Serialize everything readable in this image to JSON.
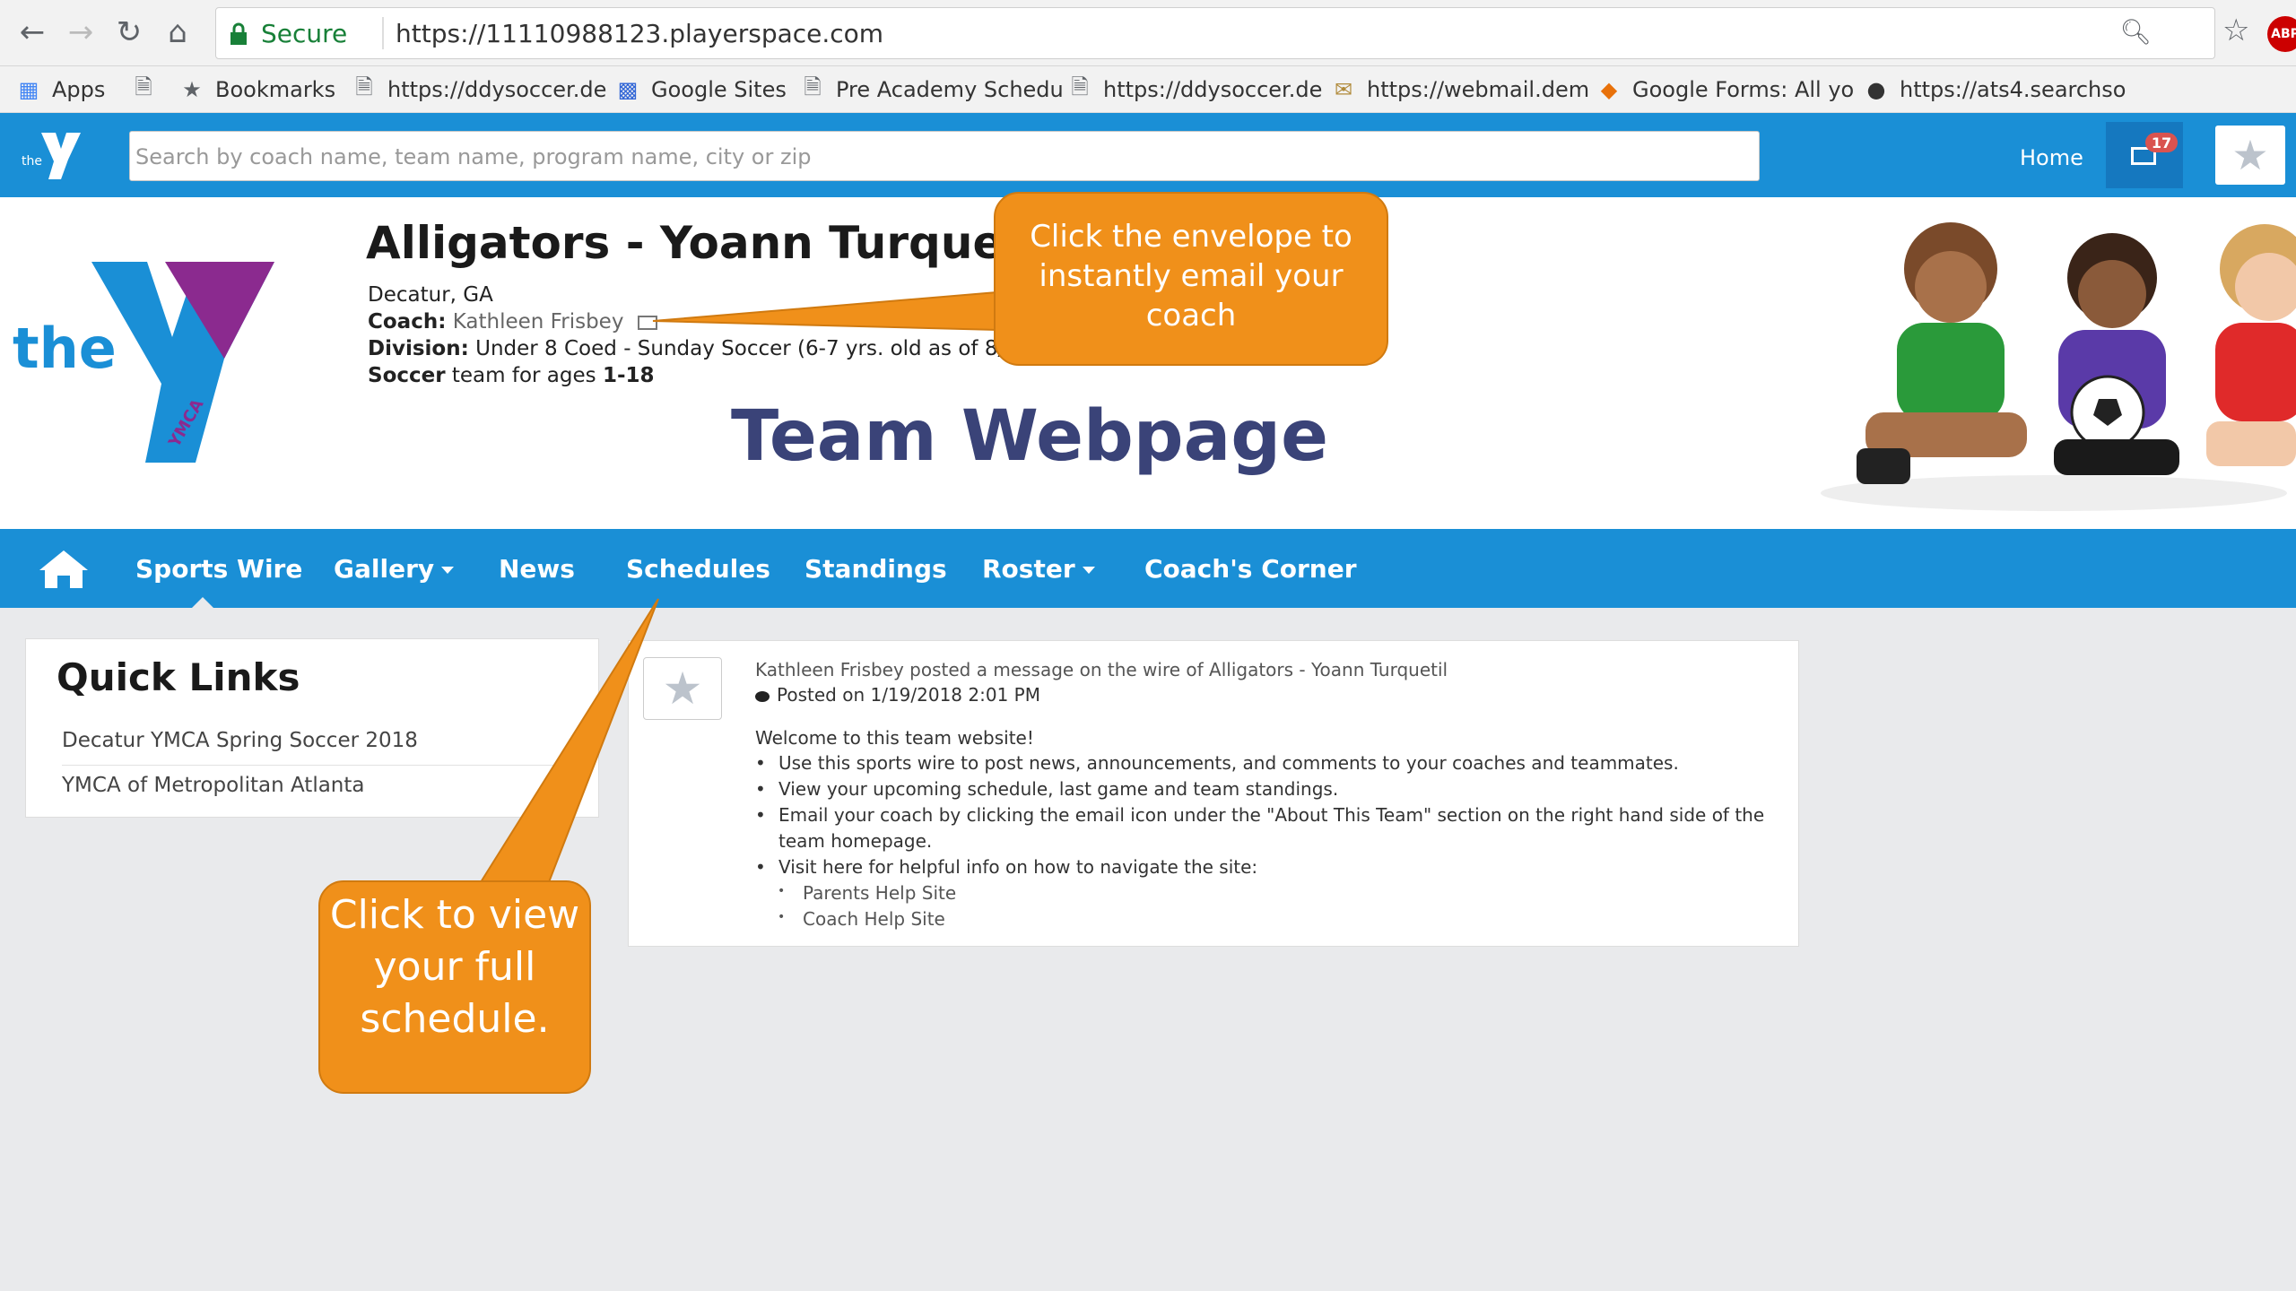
{
  "browser": {
    "secure_label": "Secure",
    "url": "https://11110988123.playerspace.com",
    "abp_label": "ABP",
    "bookmarks": [
      {
        "icon": "apps-grid-icon",
        "label": "Apps"
      },
      {
        "icon": "page-icon",
        "label": ""
      },
      {
        "icon": "star-icon",
        "label": "Bookmarks"
      },
      {
        "icon": "page-icon",
        "label": "https://ddysoccer.de"
      },
      {
        "icon": "google-sites-icon",
        "label": "Google Sites"
      },
      {
        "icon": "page-icon",
        "label": "Pre Academy Schedu"
      },
      {
        "icon": "page-icon",
        "label": "https://ddysoccer.de"
      },
      {
        "icon": "mail-icon",
        "label": "https://webmail.dem"
      },
      {
        "icon": "google-forms-icon",
        "label": "Google Forms: All yo"
      },
      {
        "icon": "ats-icon",
        "label": "https://ats4.searchso"
      }
    ]
  },
  "header": {
    "search_placeholder": "Search by coach name, team name, program name, city or zip",
    "home_label": "Home",
    "mail_badge": "17",
    "brand_color": "#1a8fd6"
  },
  "team": {
    "name": "Alligators - Yoann Turquetil",
    "location": "Decatur, GA",
    "coach_label": "Coach:",
    "coach_name": "Kathleen Frisbey",
    "division_label": "Division:",
    "division_value": "Under 8 Coed - Sunday Soccer (6-7 yrs. old as of 8/1/1",
    "sport": "Soccer",
    "ages_text": " team for ages ",
    "ages": "1-18",
    "page_title": "Team Webpage",
    "logo_text": "the",
    "logo_sub": "YMCA"
  },
  "nav": {
    "items": [
      {
        "label": "Sports Wire",
        "dropdown": false
      },
      {
        "label": "Gallery",
        "dropdown": true
      },
      {
        "label": "News",
        "dropdown": false
      },
      {
        "label": "Schedules",
        "dropdown": false
      },
      {
        "label": "Standings",
        "dropdown": false
      },
      {
        "label": "Roster",
        "dropdown": true
      },
      {
        "label": "Coach's Corner",
        "dropdown": false
      }
    ]
  },
  "quick_links": {
    "title": "Quick Links",
    "links": [
      "Decatur YMCA Spring Soccer 2018",
      "YMCA of Metropolitan Atlanta"
    ]
  },
  "post": {
    "header": "Kathleen Frisbey posted a message on the wire of Alligators - Yoann Turquetil",
    "posted": "Posted on 1/19/2018 2:01 PM",
    "welcome": "Welcome to this team website!",
    "bullets": [
      "Use this sports wire to post news, announcements, and comments to your coaches and teammates.",
      "View your upcoming schedule, last game and team standings.",
      "Email your coach by clicking the email icon under the \"About This Team\" section on the right hand side of the",
      "team homepage.",
      "Visit here for helpful info on how to navigate the site:"
    ],
    "sub_links": [
      "Parents Help Site",
      "Coach Help Site"
    ]
  },
  "callouts": {
    "email": "Click the envelope to instantly email your coach",
    "schedule": "Click to view your full schedule.",
    "color": "#f0901a"
  }
}
